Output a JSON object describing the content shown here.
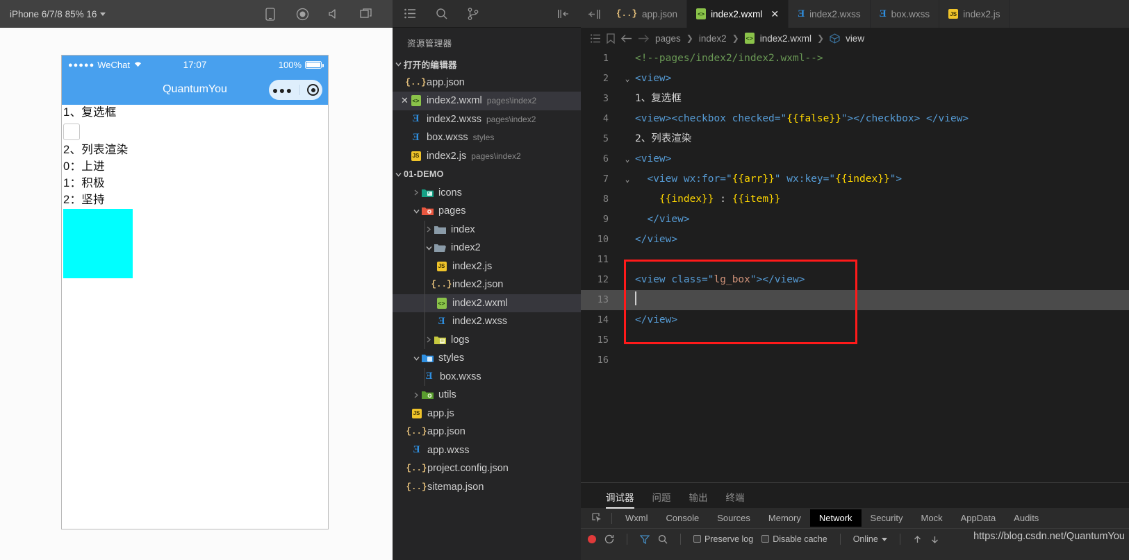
{
  "simulator": {
    "device_selector": "iPhone 6/7/8 85% 16",
    "toolbar_icons": [
      "phone-icon",
      "record-icon",
      "volume-icon",
      "window-icon"
    ],
    "status_bar": {
      "dots": "●●●●●",
      "carrier": "WeChat",
      "time": "17:07",
      "battery_percent": "100%"
    },
    "nav_title": "QuantumYou",
    "page": {
      "heading1": "1、复选框",
      "heading2": "2、列表渲染",
      "list": [
        "0：上进",
        "1：积极",
        "2：坚持"
      ],
      "box_color": "#00ffff"
    }
  },
  "explorer": {
    "title": "资源管理器",
    "icons": [
      "files-icon",
      "search-icon",
      "source-control-icon",
      "collapse-all-icon"
    ],
    "open_editors": {
      "label": "打开的编辑器",
      "items": [
        {
          "name": "app.json",
          "path": "",
          "icon": "json-icon",
          "closable": false,
          "selected": false
        },
        {
          "name": "index2.wxml",
          "path": "pages\\index2",
          "icon": "wxml-icon",
          "closable": true,
          "selected": true
        },
        {
          "name": "index2.wxss",
          "path": "pages\\index2",
          "icon": "css-icon",
          "closable": false,
          "selected": false
        },
        {
          "name": "box.wxss",
          "path": "styles",
          "icon": "css-icon",
          "closable": false,
          "selected": false
        },
        {
          "name": "index2.js",
          "path": "pages\\index2",
          "icon": "js-icon",
          "closable": false,
          "selected": false
        }
      ]
    },
    "project": {
      "label": "01-DEMO",
      "nodes": [
        {
          "name": "icons",
          "type": "folder",
          "expanded": false,
          "indent": 2,
          "icon": "folder-image-icon"
        },
        {
          "name": "pages",
          "type": "folder",
          "expanded": true,
          "indent": 2,
          "icon": "folder-pages-icon"
        },
        {
          "name": "index",
          "type": "folder",
          "expanded": false,
          "indent": 3,
          "icon": "folder-icon"
        },
        {
          "name": "index2",
          "type": "folder",
          "expanded": true,
          "indent": 3,
          "icon": "folder-open-icon"
        },
        {
          "name": "index2.js",
          "type": "file",
          "indent": 4,
          "icon": "js-icon"
        },
        {
          "name": "index2.json",
          "type": "file",
          "indent": 4,
          "icon": "json-icon"
        },
        {
          "name": "index2.wxml",
          "type": "file",
          "indent": 4,
          "icon": "wxml-icon",
          "selected": true
        },
        {
          "name": "index2.wxss",
          "type": "file",
          "indent": 4,
          "icon": "css-icon"
        },
        {
          "name": "logs",
          "type": "folder",
          "expanded": false,
          "indent": 3,
          "icon": "folder-logs-icon"
        },
        {
          "name": "styles",
          "type": "folder",
          "expanded": true,
          "indent": 2,
          "icon": "folder-styles-icon"
        },
        {
          "name": "box.wxss",
          "type": "file",
          "indent": 3,
          "icon": "css-icon"
        },
        {
          "name": "utils",
          "type": "folder",
          "expanded": false,
          "indent": 2,
          "icon": "folder-utils-icon"
        },
        {
          "name": "app.js",
          "type": "file",
          "indent": 2,
          "icon": "js-icon"
        },
        {
          "name": "app.json",
          "type": "file",
          "indent": 2,
          "icon": "json-icon"
        },
        {
          "name": "app.wxss",
          "type": "file",
          "indent": 2,
          "icon": "css-icon"
        },
        {
          "name": "project.config.json",
          "type": "file",
          "indent": 2,
          "icon": "json-icon"
        },
        {
          "name": "sitemap.json",
          "type": "file",
          "indent": 2,
          "icon": "json-icon"
        }
      ]
    }
  },
  "editor": {
    "tabs": [
      {
        "label": "app.json",
        "icon": "json-icon",
        "active": false,
        "closable": false
      },
      {
        "label": "index2.wxml",
        "icon": "wxml-icon",
        "active": true,
        "closable": true
      },
      {
        "label": "index2.wxss",
        "icon": "css-icon",
        "active": false,
        "closable": false
      },
      {
        "label": "box.wxss",
        "icon": "css-icon",
        "active": false,
        "closable": false
      },
      {
        "label": "index2.js",
        "icon": "js-icon",
        "active": false,
        "closable": false
      }
    ],
    "breadcrumb": [
      "pages",
      "index2",
      "index2.wxml",
      "view"
    ],
    "breadcrumb_icons": [
      "outline-icon",
      "bookmark-icon",
      "arrow-left-icon",
      "arrow-right-icon"
    ],
    "lines": [
      {
        "n": "1",
        "fold": ""
      },
      {
        "n": "2",
        "fold": "v"
      },
      {
        "n": "3",
        "fold": ""
      },
      {
        "n": "4",
        "fold": ""
      },
      {
        "n": "5",
        "fold": ""
      },
      {
        "n": "6",
        "fold": "v"
      },
      {
        "n": "7",
        "fold": "v"
      },
      {
        "n": "8",
        "fold": ""
      },
      {
        "n": "9",
        "fold": ""
      },
      {
        "n": "10",
        "fold": ""
      },
      {
        "n": "11",
        "fold": ""
      },
      {
        "n": "12",
        "fold": ""
      },
      {
        "n": "13",
        "fold": ""
      },
      {
        "n": "14",
        "fold": ""
      },
      {
        "n": "15",
        "fold": ""
      },
      {
        "n": "16",
        "fold": ""
      }
    ],
    "code_text": {
      "l1": "<!--pages/index2/index2.wxml-->",
      "l2": "<view>",
      "l3": "1、复选框",
      "l4_a": "<view><checkbox checked=\"",
      "l4_b": "{{false}}",
      "l4_c": "\"></checkbox> </view>",
      "l5": "2、列表渲染",
      "l6": "<view>",
      "l7_a": "<view wx:for=\"",
      "l7_b": "{{arr}}",
      "l7_c": "\" wx:key=\"",
      "l7_d": "{{index}}",
      "l7_e": "\">",
      "l8_a": "{{index}}",
      "l8_b": " : ",
      "l8_c": "{{item}}",
      "l9": "</view>",
      "l10": "</view>",
      "l12_a": "<view class=\"",
      "l12_b": "lg_box",
      "l12_c": "\"></view>",
      "l14": "</view>"
    },
    "highlight_color": "#ff1a1a"
  },
  "panel": {
    "tabs": [
      {
        "label": "调试器",
        "active": true
      },
      {
        "label": "问题",
        "active": false
      },
      {
        "label": "输出",
        "active": false
      },
      {
        "label": "终端",
        "active": false
      }
    ],
    "devtools_tabs": [
      {
        "label": "Wxml",
        "active": false
      },
      {
        "label": "Console",
        "active": false
      },
      {
        "label": "Sources",
        "active": false
      },
      {
        "label": "Memory",
        "active": false
      },
      {
        "label": "Network",
        "active": true
      },
      {
        "label": "Security",
        "active": false
      },
      {
        "label": "Mock",
        "active": false
      },
      {
        "label": "AppData",
        "active": false
      },
      {
        "label": "Audits",
        "active": false
      }
    ],
    "network_toolbar": {
      "preserve_log": "Preserve log",
      "disable_cache": "Disable cache",
      "throttling": "Online"
    }
  },
  "watermark": "https://blog.csdn.net/QuantumYou"
}
